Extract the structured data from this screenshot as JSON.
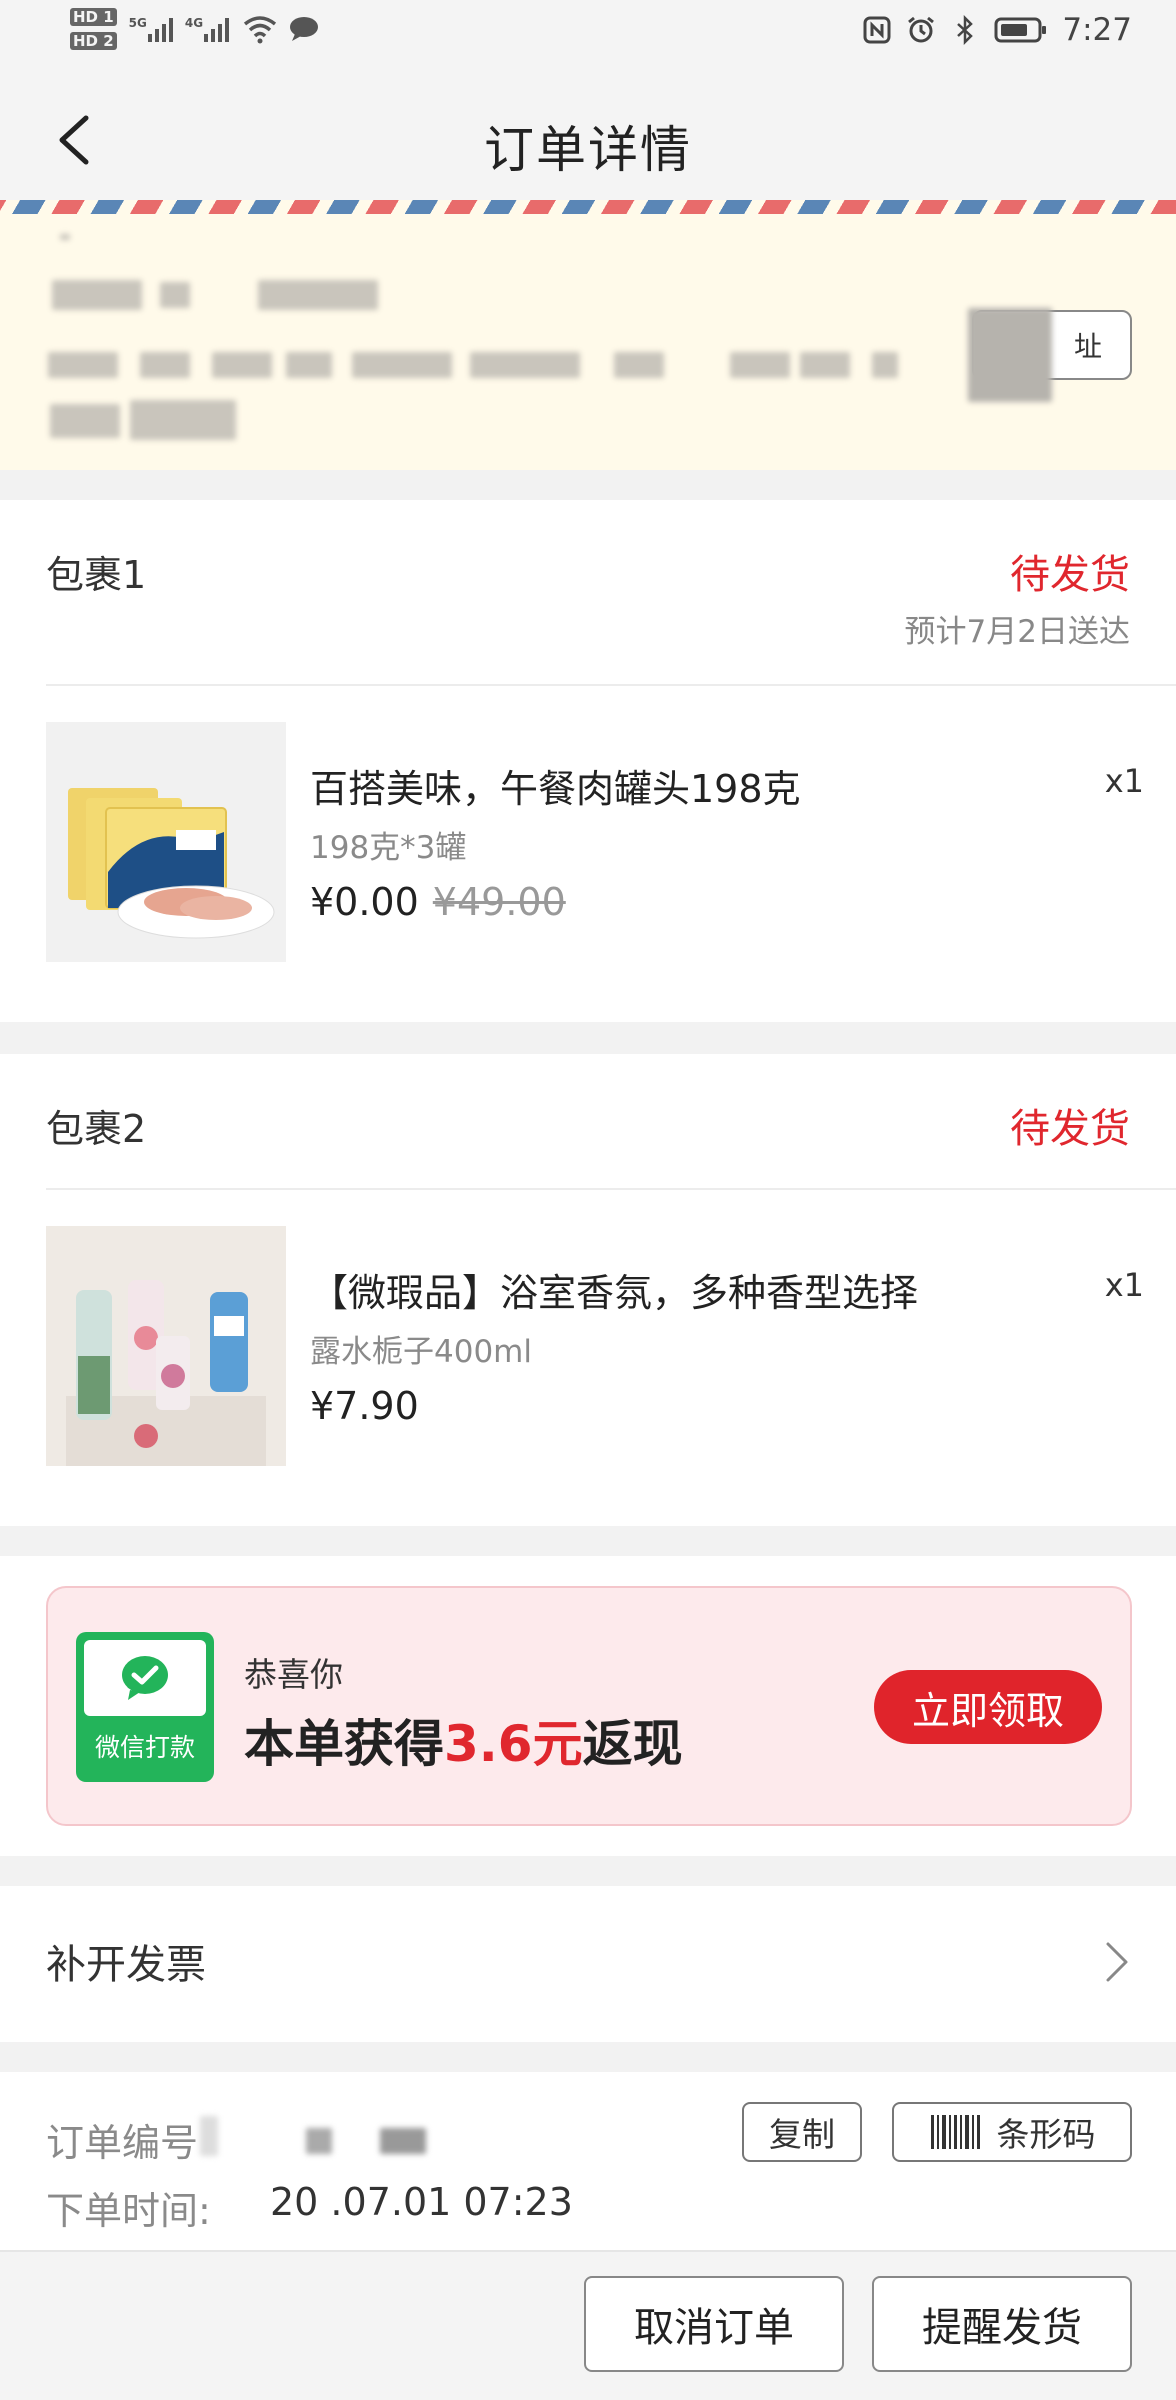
{
  "statusbar": {
    "hd1": "HD 1",
    "hd2": "HD 2",
    "net1": "5G",
    "net2": "4G",
    "time": "7:27"
  },
  "header": {
    "title": "订单详情"
  },
  "address": {
    "modify_label": "址"
  },
  "packages": [
    {
      "title": "包裹1",
      "status": "待发货",
      "eta": "预计7月2日送达",
      "item": {
        "name": "百搭美味，午餐肉罐头198克",
        "spec": "198克*3罐",
        "price": "¥0.00",
        "original_price": "¥49.00",
        "qty": "x1",
        "icon": "canned-meat-image"
      }
    },
    {
      "title": "包裹2",
      "status": "待发货",
      "item": {
        "name": "【微瑕品】浴室香氛，多种香型选择",
        "spec": "露水栀子400ml",
        "price": "¥7.90",
        "qty": "x1",
        "icon": "air-freshener-image"
      }
    }
  ],
  "cashback": {
    "badge_label": "微信打款",
    "line1": "恭喜你",
    "line2_prefix": "本单获得",
    "line2_amount": "3.6元",
    "line2_suffix": "返现",
    "button": "立即领取"
  },
  "invoice": {
    "label": "补开发票"
  },
  "order_info": {
    "number_label": "订单编号",
    "copy_button": "复制",
    "barcode_button": "条形码",
    "time_label": "下单时间:",
    "time_value": "20 .07.01 07:23"
  },
  "bottom_bar": {
    "cancel_button": "取消订单",
    "remind_button": "提醒发货"
  },
  "colors": {
    "accent_red": "#e0272e",
    "wechat_green": "#23b45a",
    "address_bg": "#fffaea"
  }
}
